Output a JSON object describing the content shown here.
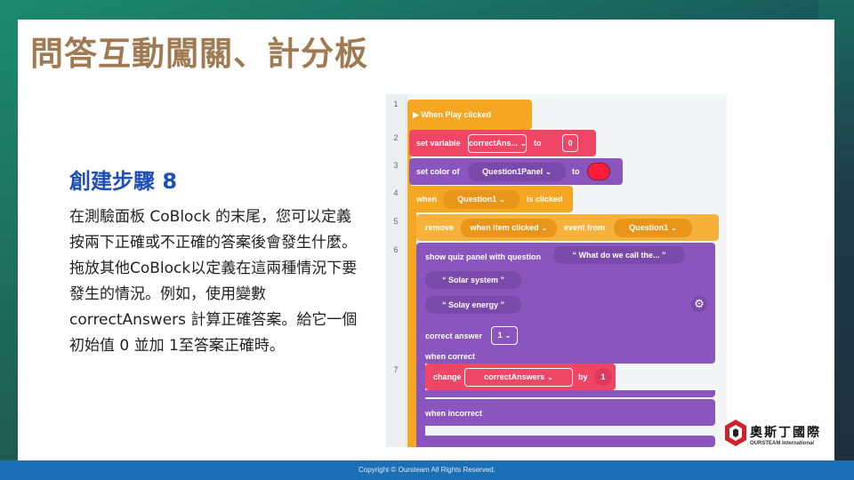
{
  "slide": {
    "title": "問答互動闖關、計分板",
    "step_title": "創建步驟 8",
    "body": "在測驗面板 CoBlock  的末尾，您可以定義按兩下正確或不正確的答案後會發生什麼。拖放其他CoBlock以定義在這兩種情況下要發生的情況。例如，使用變數 correctAnswers 計算正確答案。給它一個初始值 0 並加 1至答案正確時。"
  },
  "editor": {
    "line_numbers": [
      "1",
      "2",
      "3",
      "4",
      "5",
      "6",
      "7"
    ],
    "blocks": {
      "when_play": "When Play clicked",
      "set_variable": "set variable",
      "set_var_name": "correctAns...",
      "set_to": "to",
      "set_value": "0",
      "set_color": "set color of",
      "set_color_target": "Question1Panel",
      "set_color_to": "to",
      "when": "when",
      "when_target": "Question1",
      "is_clicked": "is clicked",
      "remove": "remove",
      "remove_event": "when item clicked",
      "event_from": "event from",
      "event_source": "Question1",
      "show_quiz": "show quiz panel with question",
      "question_text": "“ What do we call the... ”",
      "answer1": "“ Solar system ”",
      "answer2": "“ Solay energy ”",
      "correct_answer_label": "correct answer",
      "correct_answer_value": "1",
      "when_correct": "when correct",
      "change": "change",
      "change_var": "correctAnswers",
      "by": "by",
      "by_value": "1",
      "when_incorrect": "when incorrect"
    },
    "colors": {
      "orange": "#f5a623",
      "red": "#ef4665",
      "purple": "#8a56be",
      "color_swatch": "#ff1f3d"
    },
    "icons": {
      "play": "play-triangle-icon",
      "gear": "gear-icon",
      "chevron": "chevron-down-icon"
    }
  },
  "logo": {
    "cn": "奧斯丁國際",
    "en": "OURSTEAM International"
  },
  "footer": {
    "copyright": "Copyright © Oursteam All Rights Reserved."
  }
}
